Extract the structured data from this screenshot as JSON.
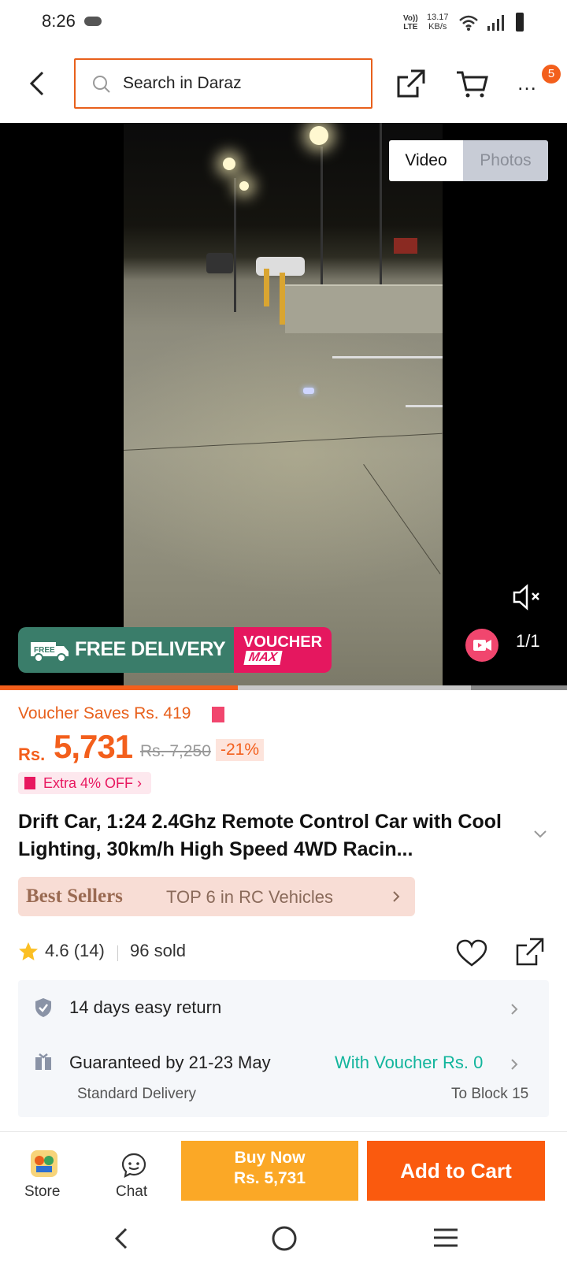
{
  "status_bar": {
    "time": "8:26",
    "network": "Vo))\nLTE",
    "speed": "13.17\nKB/s"
  },
  "header": {
    "search_placeholder": "Search in Daraz",
    "more_label": "…",
    "cart_badge": "5"
  },
  "media": {
    "tabs": [
      {
        "label": "Video",
        "active": true
      },
      {
        "label": "Photos",
        "active": false
      }
    ],
    "promo_free": "FREE DELIVERY",
    "promo_free_small": "FREE",
    "promo_voucher_1": "VOUCHER",
    "promo_voucher_2": "MAX",
    "counter": "1/1",
    "progress": 0.42
  },
  "price": {
    "voucher_saves": "Voucher Saves Rs. 419",
    "currency": "Rs.",
    "current": "5,731",
    "original": "Rs. 7,250",
    "discount": "-21%",
    "extra": "Extra 4% OFF ›"
  },
  "product": {
    "title": "Drift Car, 1:24 2.4Ghz Remote Control Car with Cool Lighting, 30km/h High Speed 4WD Racin..."
  },
  "bestseller": {
    "label": "Best Sellers",
    "text": "TOP 6 in RC Vehicles"
  },
  "rating": {
    "score": "4.6 (14)",
    "sold": "96 sold"
  },
  "service": {
    "return": "14 days easy return",
    "delivery": "Guaranteed by 21-23 May",
    "voucher": "With Voucher Rs. 0",
    "standard": "Standard Delivery",
    "block": "To Block 15"
  },
  "bottom": {
    "store": "Store",
    "chat": "Chat",
    "buy_now_1": "Buy Now",
    "buy_now_2": "Rs. 5,731",
    "add_to_cart": "Add to Cart"
  },
  "colors": {
    "accent": "#f35f1c",
    "buy_now": "#fba826",
    "add_cart": "#fa5a0e",
    "voucher_green": "#12b59c"
  }
}
